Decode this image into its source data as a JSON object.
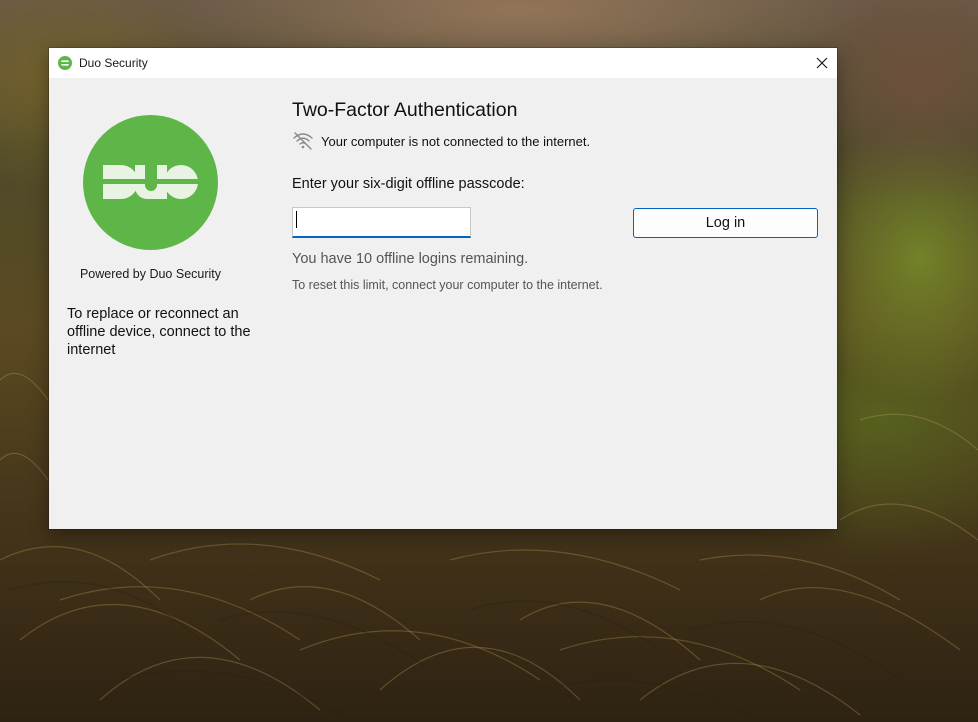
{
  "window": {
    "title": "Duo Security",
    "close_label": "Close"
  },
  "brand": {
    "logo_text": "DUO",
    "logo_color": "#5eb548",
    "powered_by": "Powered by Duo Security"
  },
  "left_note": "To replace or reconnect an offline device, connect to the internet",
  "main": {
    "heading": "Two-Factor Authentication",
    "offline_icon": "wifi-off-icon",
    "offline_message": "Your computer is not connected to the internet.",
    "prompt": "Enter your six-digit offline passcode:",
    "passcode_value": "",
    "login_label": "Log in",
    "remaining": "You have 10 offline logins remaining.",
    "reset_note": "To reset this limit, connect your computer to the internet."
  },
  "colors": {
    "accent": "#0067c0",
    "brand_green": "#5eb548"
  }
}
